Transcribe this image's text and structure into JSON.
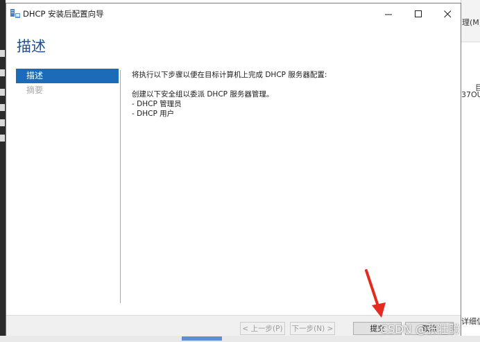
{
  "window": {
    "title": "DHCP 安装后配置向导"
  },
  "page": {
    "heading": "描述"
  },
  "nav": {
    "items": [
      {
        "label": "描述",
        "state": "active"
      },
      {
        "label": "摘要",
        "state": "disabled"
      }
    ]
  },
  "content": {
    "intro": "将执行以下步骤以便在目标计算机上完成 DHCP 服务器配置:",
    "groups_intro": "创建以下安全组以委派 DHCP 服务器管理。",
    "groups": [
      "- DHCP 管理员",
      "- DHCP 用户"
    ]
  },
  "footer": {
    "prev_label": "< 上一步(P)",
    "next_label": "下一步(N) >",
    "commit_label": "提交",
    "cancel_label": "取消"
  },
  "background_window": {
    "menu_text": "理(M)",
    "side_label": "目",
    "side_id": "37OU",
    "bottom_label": "详细信"
  },
  "watermark": "CSDN @张壮聪",
  "colors": {
    "accent": "#1c6bb8",
    "heading": "#1d4f91",
    "annotation_arrow": "#e52a1f"
  }
}
